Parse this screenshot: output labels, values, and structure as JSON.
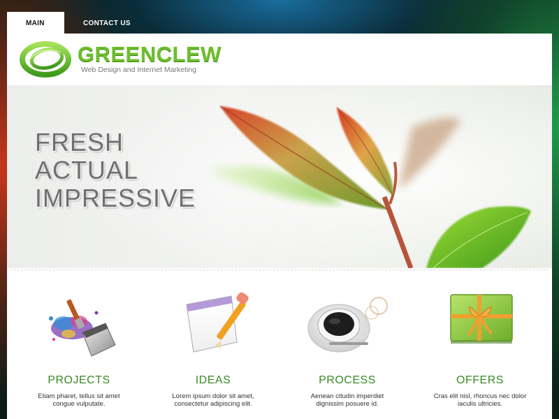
{
  "nav": {
    "tabs": [
      {
        "label": "MAIN",
        "active": true
      },
      {
        "label": "CONTACT US",
        "active": false
      }
    ]
  },
  "brand": {
    "name": "GREENCLEW",
    "tagline": "Web Design and Internet Marketing",
    "color": "#6cbf2a"
  },
  "hero": {
    "lines": [
      "FRESH",
      "ACTUAL",
      "IMPRESSIVE"
    ]
  },
  "features": [
    {
      "title": "PROJECTS",
      "desc_line1": "Etiam pharet, tellus sit amet",
      "desc_line2": "congue vulputate.",
      "icon": "paint-bucket-icon"
    },
    {
      "title": "IDEAS",
      "desc_line1": "Lorem ipsum dolor sit amet,",
      "desc_line2": "consectetur adipiscing elit.",
      "icon": "notepad-pencil-icon"
    },
    {
      "title": "PROCESS",
      "desc_line1": "Aenean citudin imperdiet",
      "desc_line2": "dignissim posuere id.",
      "icon": "coffee-cup-icon"
    },
    {
      "title": "OFFERS",
      "desc_line1": "Cras elit nisl, rhoncus nec dolor",
      "desc_line2": "iaculis ultricies.",
      "icon": "gift-box-icon"
    }
  ]
}
